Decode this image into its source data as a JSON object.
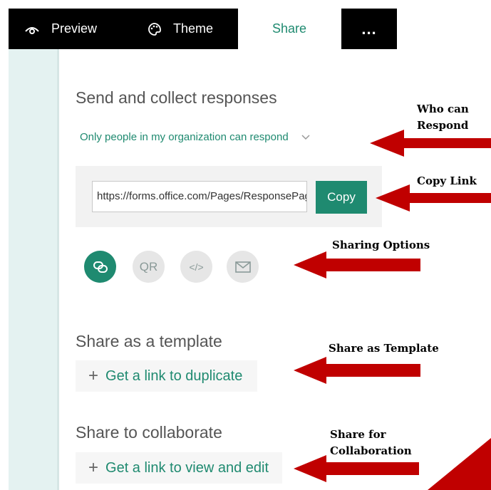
{
  "topbar": {
    "preview_label": "Preview",
    "theme_label": "Theme",
    "share_label": "Share",
    "more_label": "..."
  },
  "send": {
    "heading": "Send and collect responses",
    "who_can_respond": "Only people in my organization can respond",
    "link_value": "https://forms.office.com/Pages/ResponsePage.aspx",
    "copy_label": "Copy",
    "options": {
      "qr_label": "QR",
      "embed_label": "</>"
    }
  },
  "template": {
    "heading": "Share as a template",
    "link_label": "Get a link to duplicate"
  },
  "collaborate": {
    "heading": "Share to collaborate",
    "link_label": "Get a link to view and edit"
  },
  "annotations": {
    "who_line1": "Who can",
    "who_line2": "Respond",
    "copy_link": "Copy Link",
    "sharing_options": "Sharing Options",
    "share_template": "Share as Template",
    "collab_line1": "Share for",
    "collab_line2": "Collaboration"
  },
  "colors": {
    "accent": "#1f8a70",
    "arrow": "#c00000"
  }
}
